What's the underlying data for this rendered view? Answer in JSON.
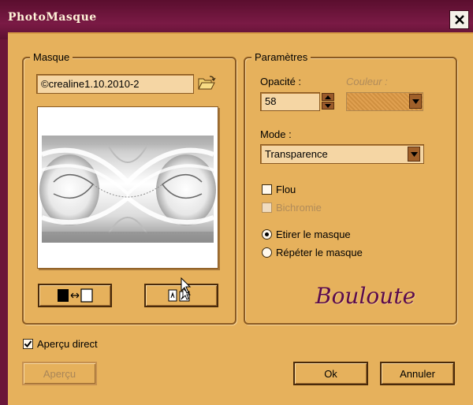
{
  "window": {
    "title": "PhotoMasque"
  },
  "mask_group": {
    "label": "Masque",
    "mask_name": "©crealine1.10.2010-2",
    "browse_icon": "folder-open-icon",
    "invert_icon": "invert-mask-icon",
    "fit_icon": "fit-mask-icon"
  },
  "params_group": {
    "label": "Paramètres",
    "opacity_label": "Opacité :",
    "opacity_value": "58",
    "color_label": "Couleur :",
    "mode_label": "Mode :",
    "mode_value": "Transparence",
    "blur_label": "Flou",
    "blur_checked": false,
    "bichromie_label": "Bichromie",
    "bichromie_checked": false,
    "stretch_label": "Etirer le masque",
    "repeat_label": "Répéter le masque",
    "selected_fill": "stretch"
  },
  "signature": "Bouloute",
  "live_preview": {
    "label": "Aperçu direct",
    "checked": true
  },
  "buttons": {
    "preview": "Aperçu",
    "ok": "Ok",
    "cancel": "Annuler"
  },
  "colors": {
    "dialog_bg": "#e6b15c",
    "titlebar": "#6b1538",
    "signature": "#5a0b4d"
  }
}
